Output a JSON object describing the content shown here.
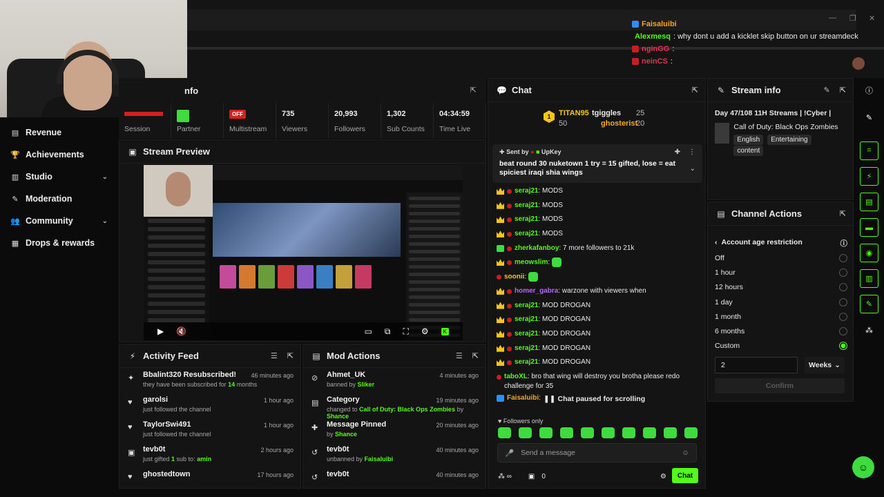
{
  "overlay_chat": [
    {
      "name": "Faisaluibi",
      "name_color": "#f5a623",
      "text": "",
      "badge": "#2f8ef5"
    },
    {
      "name": "Alexmesq",
      "name_color": "#53fc18",
      "text": ": why dont u add a kicklet skip button on ur streamdeck",
      "badge": "#c71e1e"
    },
    {
      "name": "nginGG",
      "name_color": "#e0344f",
      "text": ":",
      "badge": "#c71e1e"
    },
    {
      "name": "neinCS",
      "name_color": "#e0344f",
      "text": ":",
      "badge": "#c71e1e"
    }
  ],
  "sidebar": {
    "items": [
      {
        "label": "Revenue",
        "icon": "revenue-icon",
        "glyph": "▤",
        "chevron": false
      },
      {
        "label": "Achievements",
        "icon": "trophy-icon",
        "glyph": "🏆",
        "chevron": false
      },
      {
        "label": "Studio",
        "icon": "studio-icon",
        "glyph": "▥",
        "chevron": true
      },
      {
        "label": "Moderation",
        "icon": "wrench-icon",
        "glyph": "✎",
        "chevron": false
      },
      {
        "label": "Community",
        "icon": "community-icon",
        "glyph": "👥",
        "chevron": true
      },
      {
        "label": "Drops & rewards",
        "icon": "drops-icon",
        "glyph": "▦",
        "chevron": false
      }
    ]
  },
  "stats": {
    "title_fragment": "nfo",
    "cells": [
      {
        "value": "",
        "label": "Session",
        "kind": "session"
      },
      {
        "value": "",
        "label": "Partner",
        "kind": "partner"
      },
      {
        "value": "OFF",
        "label": "Multistream",
        "kind": "off"
      },
      {
        "value": "735",
        "label": "Viewers",
        "kind": "text"
      },
      {
        "value": "20,993",
        "label": "Followers",
        "kind": "text"
      },
      {
        "value": "1,302",
        "label": "Sub Counts",
        "kind": "text"
      },
      {
        "value": "04:34:59",
        "label": "Time Live",
        "kind": "text"
      }
    ]
  },
  "preview": {
    "title": "Stream Preview"
  },
  "activity": {
    "title": "Activity Feed",
    "rows": [
      {
        "icon": "sparkle-icon",
        "glyph": "✦",
        "title": "Bbalint320 Resubscribed!",
        "sub_pre": "they have been subscribed for ",
        "sub_hl": "14",
        "sub_post": " months",
        "time": "46 minutes ago"
      },
      {
        "icon": "heart-icon",
        "glyph": "♥",
        "title": "garolsi",
        "sub_pre": "just followed the channel",
        "sub_hl": "",
        "sub_post": "",
        "time": "1 hour ago"
      },
      {
        "icon": "heart-icon",
        "glyph": "♥",
        "title": "TaylorSwi491",
        "sub_pre": "just followed the channel",
        "sub_hl": "",
        "sub_post": "",
        "time": "1 hour ago"
      },
      {
        "icon": "gift-icon",
        "glyph": "▣",
        "title": "tevb0t",
        "sub_pre": "just gifted ",
        "sub_hl": "1",
        "sub_post": " sub to: ",
        "sub_hl2": "amin",
        "time": "2 hours ago"
      },
      {
        "icon": "heart-icon",
        "glyph": "♥",
        "title": "ghostedtown",
        "sub_pre": "",
        "sub_hl": "",
        "sub_post": "",
        "time": "17 hours ago"
      }
    ]
  },
  "mod_actions": {
    "title": "Mod Actions",
    "rows": [
      {
        "icon": "ban-icon",
        "glyph": "⊘",
        "title": "Ahmet_UK",
        "sub_pre": "banned by ",
        "sub_hl": "Sliker",
        "time": "4 minutes ago"
      },
      {
        "icon": "category-icon",
        "glyph": "▤",
        "title": "Category",
        "sub_pre": "changed to ",
        "sub_hl": "Call of Duty: Black Ops Zombies",
        "sub_post": " by ",
        "sub_hl2": "Shance",
        "time": "19 minutes ago"
      },
      {
        "icon": "pin-icon",
        "glyph": "✚",
        "title": "Message Pinned",
        "sub_pre": "by ",
        "sub_hl": "Shance",
        "time": "20 minutes ago"
      },
      {
        "icon": "undo-icon",
        "glyph": "↺",
        "title": "tevb0t",
        "sub_pre": "unbanned by ",
        "sub_hl": "Faisaluibi",
        "time": "40 minutes ago"
      },
      {
        "icon": "undo-icon",
        "glyph": "↺",
        "title": "tevb0t",
        "sub_pre": "",
        "sub_hl": "",
        "time": "40 minutes ago"
      }
    ]
  },
  "chat": {
    "title": "Chat",
    "leaderboard": {
      "rank": "1",
      "first": {
        "name": "TITAN95",
        "score": "50"
      },
      "second": {
        "name": "tgiggles",
        "score": "25"
      },
      "third": {
        "name": "ghosterist",
        "score": "20"
      }
    },
    "pinned": {
      "sent_by_label": "Sent by",
      "sender": "UpKey",
      "message": "beat round 30 nuketown 1 try = 15 gifted, lose = eat spiciest iraqi shia wings"
    },
    "messages": [
      {
        "badge": "crown-b",
        "name": "seraj21",
        "color": "#53fc18",
        "text": ": MODS"
      },
      {
        "badge": "crown-b",
        "name": "seraj21",
        "color": "#53fc18",
        "text": ": MODS"
      },
      {
        "badge": "crown-b",
        "name": "seraj21",
        "color": "#53fc18",
        "text": ": MODS"
      },
      {
        "badge": "crown-b",
        "name": "seraj21",
        "color": "#53fc18",
        "text": ": MODS"
      },
      {
        "badge": "green-b",
        "name": "zherkafanboy",
        "color": "#53fc18",
        "text": ": 7 more followers to 21k"
      },
      {
        "badge": "crown-b",
        "name": "meowslim",
        "color": "#53fc18",
        "text": ":",
        "emote": true
      },
      {
        "badge": "red-b",
        "name": "soonii",
        "color": "#f5c518",
        "text": ":",
        "emote": true
      },
      {
        "badge": "crown-b",
        "name": "homer_gabra",
        "color": "#b26cf5",
        "text": ": warzone with viewers when"
      },
      {
        "badge": "crown-b",
        "name": "seraj21",
        "color": "#53fc18",
        "text": ": MOD DROGAN"
      },
      {
        "badge": "crown-b",
        "name": "seraj21",
        "color": "#53fc18",
        "text": ": MOD DROGAN"
      },
      {
        "badge": "crown-b",
        "name": "seraj21",
        "color": "#53fc18",
        "text": ": MOD DROGAN"
      },
      {
        "badge": "crown-b",
        "name": "seraj21",
        "color": "#53fc18",
        "text": ": MOD DROGAN"
      },
      {
        "badge": "crown-b",
        "name": "seraj21",
        "color": "#53fc18",
        "text": ": MOD DROGAN"
      },
      {
        "badge": "red-b",
        "name": "taboXL",
        "color": "#53fc18",
        "text": ": bro that wing will destroy you brotha please redo challenge for 35"
      },
      {
        "badge": "blue-b",
        "name": "Faisaluibi",
        "color": "#f5a623",
        "text": ":"
      }
    ],
    "paused_label": "Chat paused for scrolling",
    "followers_only": "Followers only",
    "send_placeholder": "Send a message",
    "footer_count": "0",
    "chat_button": "Chat"
  },
  "stream_info": {
    "title": "Stream info",
    "stream_title": "Day 47/108 11H Streams | !Cyber |",
    "category": "Call of Duty: Black Ops Zombies",
    "tags": [
      "English",
      "Entertaining",
      "content"
    ]
  },
  "channel_actions": {
    "title": "Channel Actions",
    "subtitle": "Account age restriction",
    "options": [
      {
        "label": "Off",
        "selected": false
      },
      {
        "label": "1 hour",
        "selected": false
      },
      {
        "label": "12 hours",
        "selected": false
      },
      {
        "label": "1 day",
        "selected": false
      },
      {
        "label": "1 month",
        "selected": false
      },
      {
        "label": "6 months",
        "selected": false
      },
      {
        "label": "Custom",
        "selected": true
      }
    ],
    "custom_value": "2",
    "unit": "Weeks",
    "confirm_label": "Confirm"
  },
  "colors": {
    "accent": "#53fc18",
    "danger": "#d61f1f",
    "panel": "#141414"
  }
}
